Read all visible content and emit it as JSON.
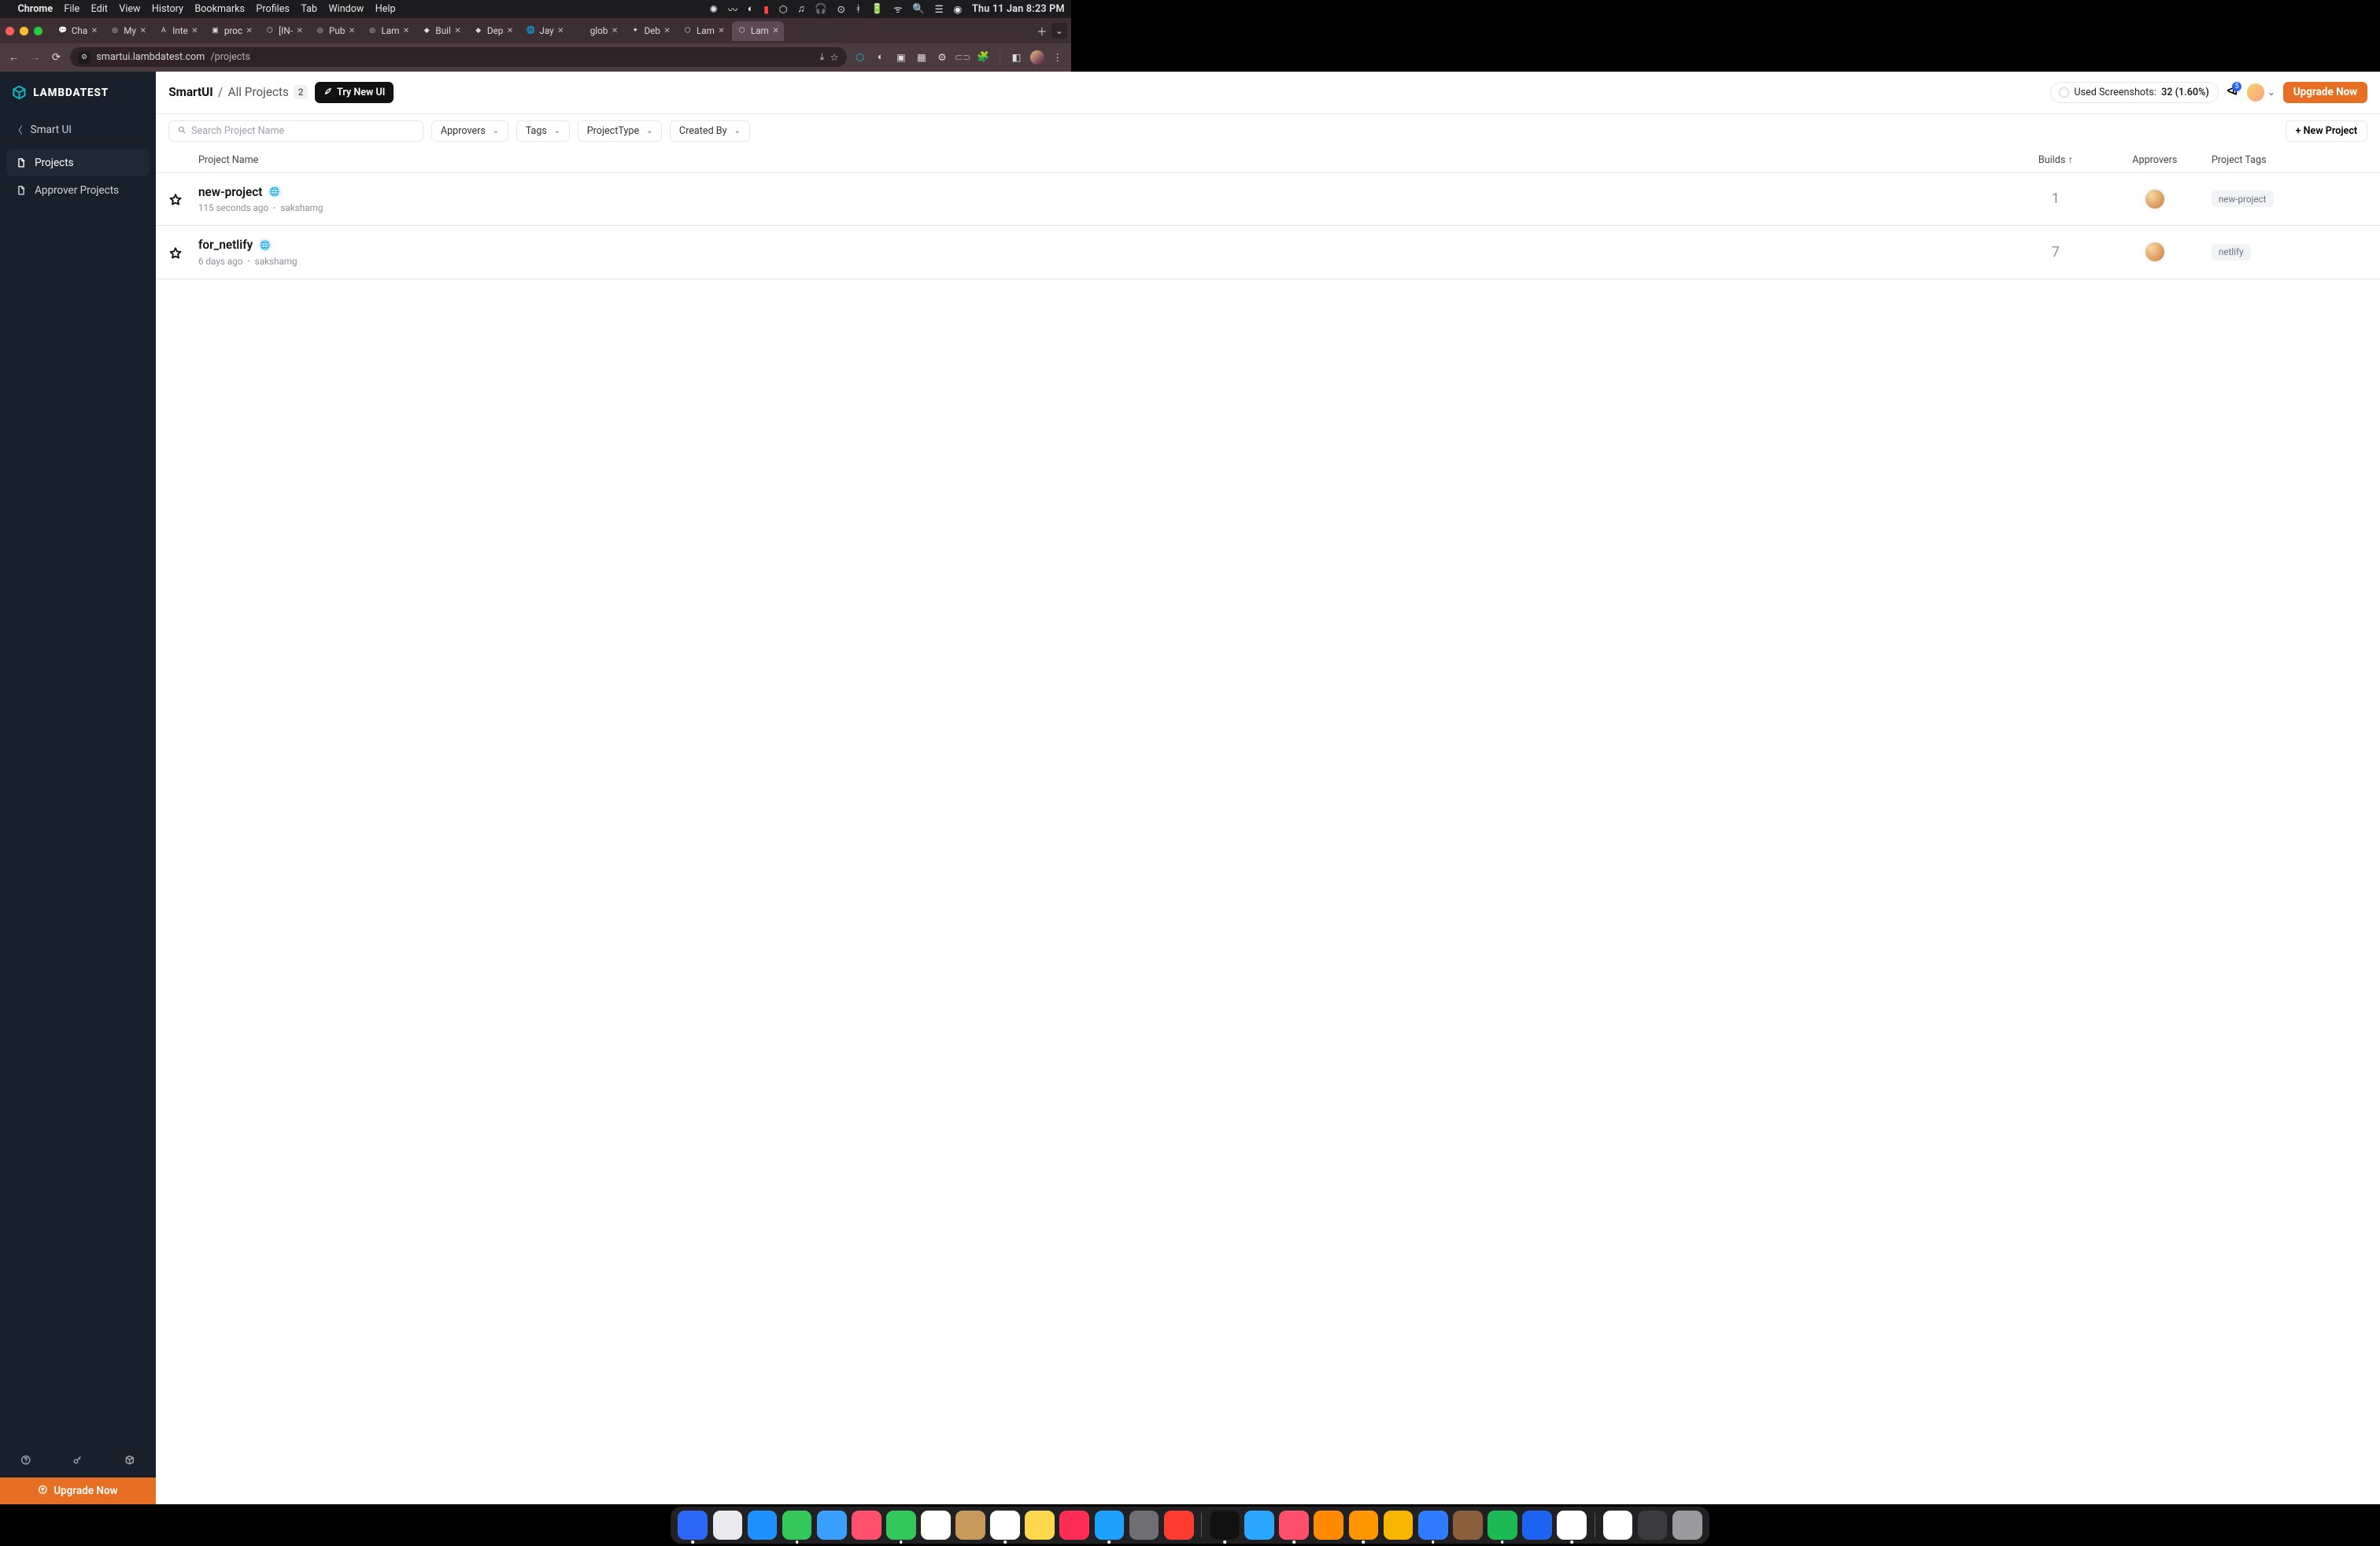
{
  "mac": {
    "app": "Chrome",
    "menus": [
      "File",
      "Edit",
      "View",
      "History",
      "Bookmarks",
      "Profiles",
      "Tab",
      "Window",
      "Help"
    ],
    "clock": "Thu 11 Jan  8:23 PM"
  },
  "chrome": {
    "tabs": [
      {
        "title": "Cha",
        "fav": "💬"
      },
      {
        "title": "My",
        "fav": "◎"
      },
      {
        "title": "Inte",
        "fav": "A"
      },
      {
        "title": "proc",
        "fav": "▣"
      },
      {
        "title": "[IN-",
        "fav": "⬡"
      },
      {
        "title": "Pub",
        "fav": "◎"
      },
      {
        "title": "Lam",
        "fav": "◎"
      },
      {
        "title": "Buil",
        "fav": "◆"
      },
      {
        "title": "Dep",
        "fav": "◆"
      },
      {
        "title": "Jay",
        "fav": "🌐"
      },
      {
        "title": "glob",
        "fav": ""
      },
      {
        "title": "Deb",
        "fav": "✦"
      },
      {
        "title": "Lam",
        "fav": "⬡"
      },
      {
        "title": "Lam",
        "fav": "⬡",
        "active": true
      }
    ],
    "url_host": "smartui.lambdatest.com",
    "url_path": "/projects"
  },
  "sidebar": {
    "brand": "LAMBDATEST",
    "back": "Smart UI",
    "items": [
      {
        "label": "Projects",
        "active": true
      },
      {
        "label": "Approver Projects",
        "active": false
      }
    ],
    "upgrade": "Upgrade Now"
  },
  "topbar": {
    "crumb_root": "SmartUI",
    "crumb_leaf": "All Projects",
    "count": "2",
    "try_new": "Try New UI",
    "usage_label": "Used Screenshots:",
    "usage_value": "32 (1.60%)",
    "notif_count": "5",
    "upgrade": "Upgrade Now"
  },
  "filters": {
    "search_placeholder": "Search Project Name",
    "approvers": "Approvers",
    "tags": "Tags",
    "project_type": "ProjectType",
    "created_by": "Created By",
    "new_project": "+ New Project"
  },
  "table": {
    "headers": {
      "name": "Project Name",
      "builds": "Builds",
      "approvers": "Approvers",
      "tags": "Project Tags"
    },
    "rows": [
      {
        "name": "new-project",
        "age": "115 seconds ago",
        "author": "sakshamg",
        "builds": "1",
        "tag": "new-project"
      },
      {
        "name": "for_netlify",
        "age": "6 days ago",
        "author": "sakshamg",
        "builds": "7",
        "tag": "netlify"
      }
    ]
  },
  "dock": {
    "icons": [
      "#2b66f6",
      "#e9e9ee",
      "#1e90ff",
      "#34c759",
      "#3aa0ff",
      "#ff4f6d",
      "#34c759",
      "#ffffff",
      "#c79a5b",
      "#ffffff",
      "#ffd84d",
      "#ff2d55",
      "#1ea0ff",
      "#6e6e73",
      "#ff3b30"
    ],
    "icons2": [
      "#111111",
      "#2aa6ff",
      "#ff4f6d",
      "#ff8a00",
      "#ff9500",
      "#f7b500",
      "#2f7bff",
      "#8b5e3c",
      "#1db954",
      "#1d62f0",
      "#ffffff"
    ],
    "tray": [
      "#ffffff",
      "#3a3a3c",
      "#9a9a9d"
    ]
  }
}
